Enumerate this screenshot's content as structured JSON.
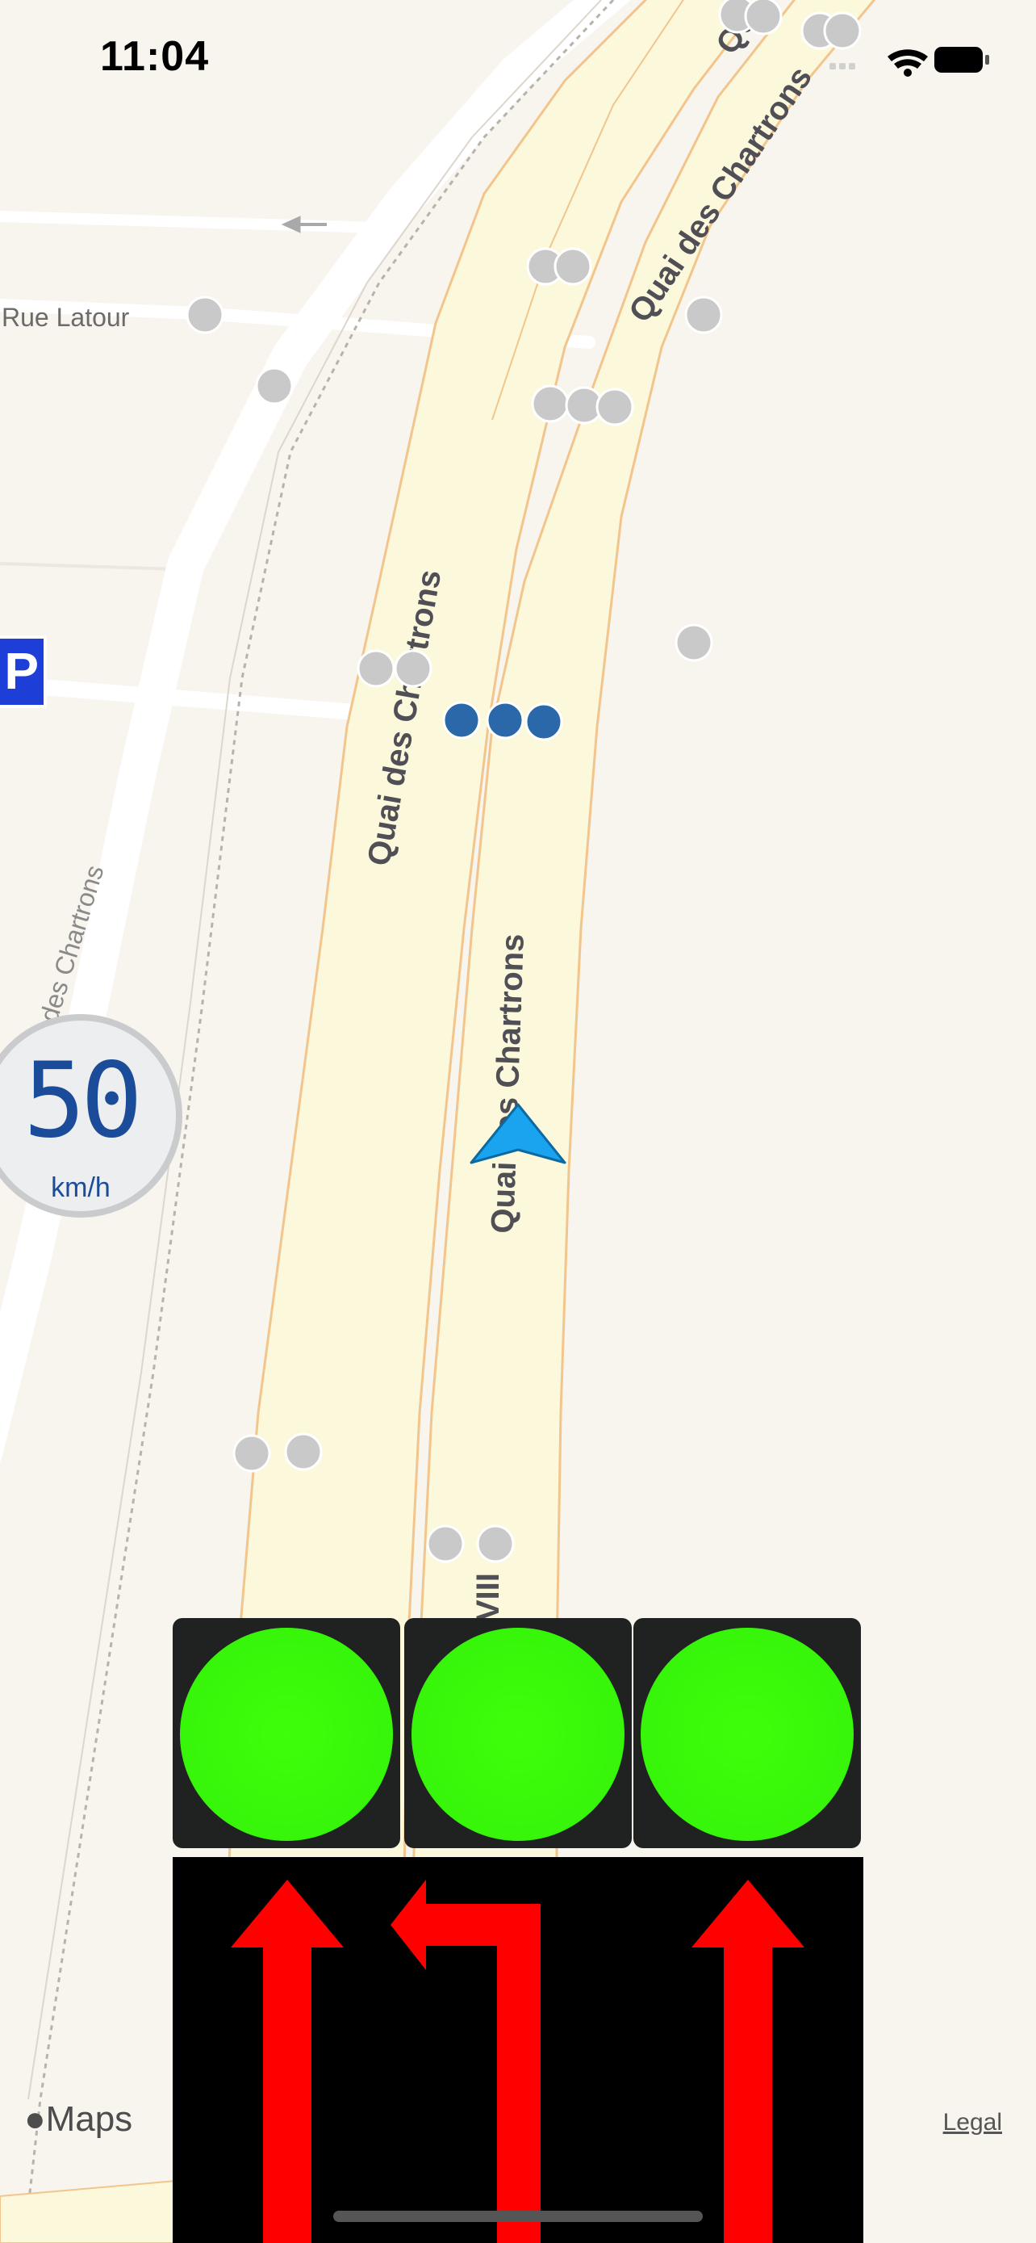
{
  "status_bar": {
    "time": "11:04"
  },
  "map": {
    "streets": {
      "rue_latour": "Rue Latour",
      "quai_top": "Quai des Chartrons",
      "quai_left": "Quai des Chartrons",
      "quai_center": "Quai des Chartrons",
      "left_road": "des Chartrons",
      "top_fragment": "Qu",
      "bottom_fragment": "VIII"
    }
  },
  "speed_limit": {
    "value": "50",
    "unit": "km/h"
  },
  "parking_sign": "P",
  "traffic_signals": [
    {
      "lane": 1,
      "state": "green",
      "color": "#3dff0a"
    },
    {
      "lane": 2,
      "state": "green",
      "color": "#3dff0a"
    },
    {
      "lane": 3,
      "state": "green",
      "color": "#3dff0a"
    }
  ],
  "lane_arrows": [
    {
      "lane": 1,
      "direction": "straight",
      "color": "#ff0000"
    },
    {
      "lane": 2,
      "direction": "left",
      "color": "#ff0000"
    },
    {
      "lane": 3,
      "direction": "straight",
      "color": "#ff0000"
    }
  ],
  "footer": {
    "maps_label": "Maps",
    "legal_label": "Legal"
  },
  "colors": {
    "map_background": "#f8f4ee",
    "road_fill": "#fcf8dc",
    "road_border": "#f0c080",
    "position_arrow": "#1aa3ee",
    "route_dots": "#2a68a9",
    "poi_dots": "#c9c9c9"
  }
}
